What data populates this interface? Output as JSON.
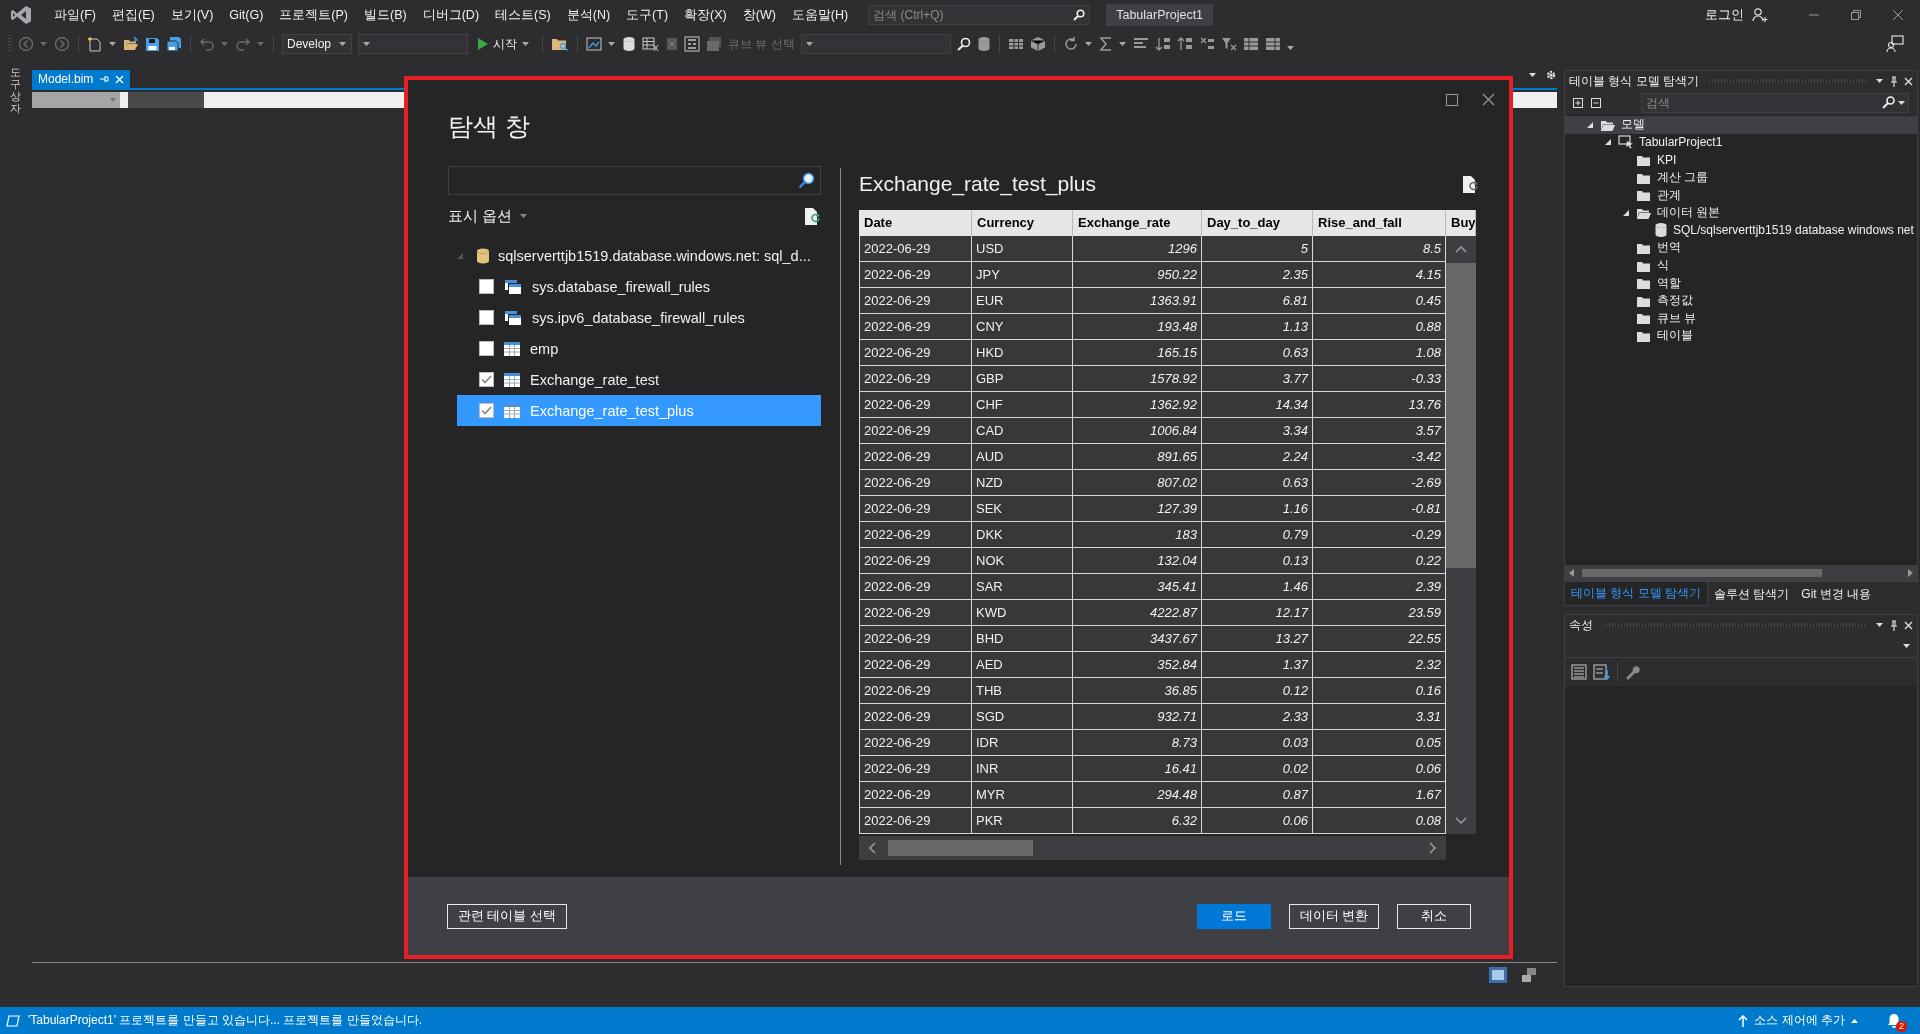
{
  "title_bar": {
    "menus": [
      "파일(F)",
      "편집(E)",
      "보기(V)",
      "Git(G)",
      "프로젝트(P)",
      "빌드(B)",
      "디버그(D)",
      "테스트(S)",
      "분석(N)",
      "도구(T)",
      "확장(X)",
      "창(W)",
      "도움말(H)"
    ],
    "search": {
      "placeholder": "검색 (Ctrl+Q)"
    },
    "project_title": "TabularProject1",
    "sign_in": "로그인"
  },
  "toolbar": {
    "configuration": "Develop",
    "start": "시작",
    "cube_view": {
      "label": "큐브 뷰 선택",
      "disabled": true
    }
  },
  "toolbox_tab": "도구 상자",
  "document_tab": {
    "title": "Model.bim",
    "selected": true
  },
  "dialog": {
    "title": "탐색 창",
    "display_options": "표시 옵션",
    "source": {
      "label": "sqlserverttjb1519.database.windows.net: sql_d...",
      "expanded": true,
      "children": [
        {
          "label": "sys.database_firewall_rules",
          "kind": "view",
          "checked": false,
          "selected": false
        },
        {
          "label": "sys.ipv6_database_firewall_rules",
          "kind": "view",
          "checked": false,
          "selected": false
        },
        {
          "label": "emp",
          "kind": "table",
          "checked": false,
          "selected": false
        },
        {
          "label": "Exchange_rate_test",
          "kind": "table",
          "checked": true,
          "selected": false
        },
        {
          "label": "Exchange_rate_test_plus",
          "kind": "table",
          "checked": true,
          "selected": true
        }
      ]
    },
    "preview": {
      "title": "Exchange_rate_test_plus",
      "columns": [
        "Date",
        "Currency",
        "Exchange_rate",
        "Day_to_day",
        "Rise_and_fall",
        "Buy"
      ],
      "rows": [
        [
          "2022-06-29",
          "USD",
          "1296",
          "5",
          "8.5"
        ],
        [
          "2022-06-29",
          "JPY",
          "950.22",
          "2.35",
          "4.15"
        ],
        [
          "2022-06-29",
          "EUR",
          "1363.91",
          "6.81",
          "0.45"
        ],
        [
          "2022-06-29",
          "CNY",
          "193.48",
          "1.13",
          "0.88"
        ],
        [
          "2022-06-29",
          "HKD",
          "165.15",
          "0.63",
          "1.08"
        ],
        [
          "2022-06-29",
          "GBP",
          "1578.92",
          "3.77",
          "-0.33"
        ],
        [
          "2022-06-29",
          "CHF",
          "1362.92",
          "14.34",
          "13.76"
        ],
        [
          "2022-06-29",
          "CAD",
          "1006.84",
          "3.34",
          "3.57"
        ],
        [
          "2022-06-29",
          "AUD",
          "891.65",
          "2.24",
          "-3.42"
        ],
        [
          "2022-06-29",
          "NZD",
          "807.02",
          "0.63",
          "-2.69"
        ],
        [
          "2022-06-29",
          "SEK",
          "127.39",
          "1.16",
          "-0.81"
        ],
        [
          "2022-06-29",
          "DKK",
          "183",
          "0.79",
          "-0.29"
        ],
        [
          "2022-06-29",
          "NOK",
          "132.04",
          "0.13",
          "0.22"
        ],
        [
          "2022-06-29",
          "SAR",
          "345.41",
          "1.46",
          "2.39"
        ],
        [
          "2022-06-29",
          "KWD",
          "4222.87",
          "12.17",
          "23.59"
        ],
        [
          "2022-06-29",
          "BHD",
          "3437.67",
          "13.27",
          "22.55"
        ],
        [
          "2022-06-29",
          "AED",
          "352.84",
          "1.37",
          "2.32"
        ],
        [
          "2022-06-29",
          "THB",
          "36.85",
          "0.12",
          "0.16"
        ],
        [
          "2022-06-29",
          "SGD",
          "932.71",
          "2.33",
          "3.31"
        ],
        [
          "2022-06-29",
          "IDR",
          "8.73",
          "0.03",
          "0.05"
        ],
        [
          "2022-06-29",
          "INR",
          "16.41",
          "0.02",
          "0.06"
        ],
        [
          "2022-06-29",
          "MYR",
          "294.48",
          "0.87",
          "1.67"
        ],
        [
          "2022-06-29",
          "PKR",
          "6.32",
          "0.06",
          "0.08"
        ]
      ]
    },
    "buttons": [
      {
        "label": "관련 테이블 선택",
        "primary": false
      },
      {
        "label": "로드",
        "primary": true
      },
      {
        "label": "데이터 변환",
        "primary": false
      },
      {
        "label": "취소",
        "primary": false
      }
    ]
  },
  "model_explorer": {
    "title": "테이블 형식 모델 탐색기",
    "search": {
      "placeholder": "검색"
    },
    "tree": [
      {
        "label": "모델",
        "kind": "model",
        "expanded": true,
        "selected": true,
        "children": [
          {
            "label": "TabularProject1",
            "kind": "project",
            "expanded": true,
            "selected": false,
            "children": [
              {
                "label": "KPI",
                "kind": "folder",
                "selected": false
              },
              {
                "label": "계산 그룹",
                "kind": "folder",
                "selected": false
              },
              {
                "label": "관계",
                "kind": "folder",
                "selected": false
              },
              {
                "label": "데이터 원본",
                "kind": "folder",
                "expanded": true,
                "selected": false,
                "children": [
                  {
                    "label": "SQL/sqlserverttjb1519 database windows net",
                    "kind": "datasource",
                    "selected": false
                  }
                ]
              },
              {
                "label": "번역",
                "kind": "folder",
                "selected": false
              },
              {
                "label": "식",
                "kind": "folder",
                "selected": false
              },
              {
                "label": "역할",
                "kind": "folder",
                "selected": false
              },
              {
                "label": "측정값",
                "kind": "folder",
                "selected": false
              },
              {
                "label": "큐브 뷰",
                "kind": "folder",
                "selected": false
              },
              {
                "label": "테이블",
                "kind": "folder",
                "selected": false
              }
            ]
          }
        ]
      }
    ],
    "tabs": [
      {
        "label": "테이블 형식 모델 탐색기",
        "selected": true
      },
      {
        "label": "솔루션 탐색기",
        "selected": false
      },
      {
        "label": "Git 변경 내용",
        "selected": false
      }
    ]
  },
  "properties": {
    "title": "속성"
  },
  "status_bar": {
    "message": "'TabularProject1' 프로젝트를 만들고 있습니다... 프로젝트를 만들었습니다.",
    "source_control": "소스 제어에 추가",
    "notifications": "2"
  }
}
